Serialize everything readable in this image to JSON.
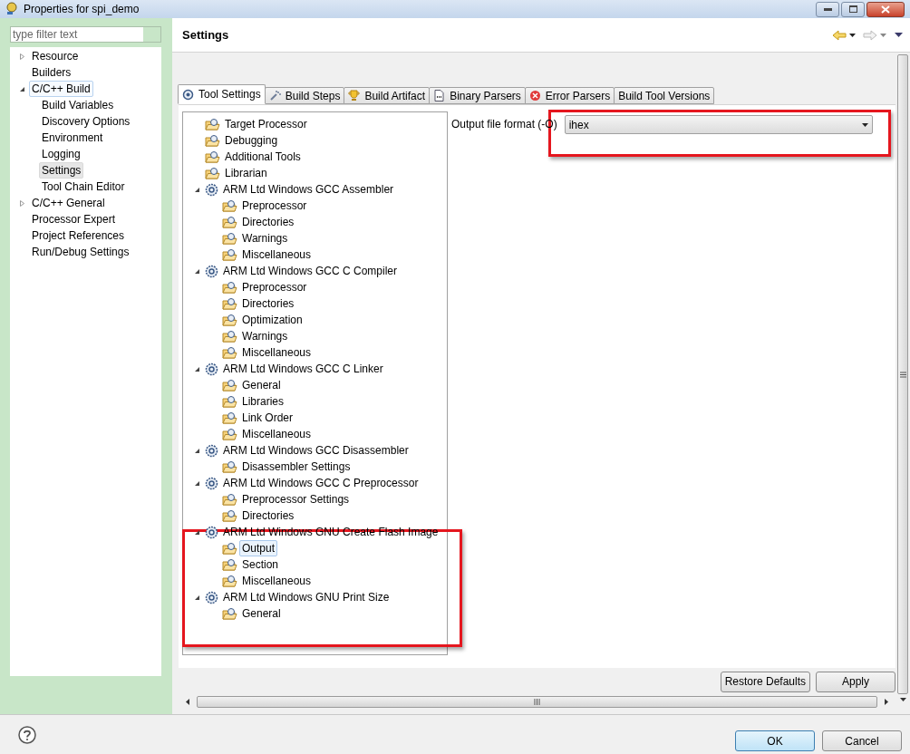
{
  "window": {
    "title": "Properties for spi_demo"
  },
  "sidebar": {
    "filter": {
      "placeholder": "type filter text"
    },
    "items": [
      {
        "label": "Resource",
        "expanded": false,
        "selected": false,
        "focused": false
      },
      {
        "label": "Builders",
        "selected": false,
        "focused": false
      },
      {
        "label": "C/C++ Build",
        "expanded": true,
        "selected": false,
        "focused": true,
        "children": [
          {
            "label": "Build Variables",
            "selected": false
          },
          {
            "label": "Discovery Options",
            "selected": false
          },
          {
            "label": "Environment",
            "selected": false
          },
          {
            "label": "Logging",
            "selected": false
          },
          {
            "label": "Settings",
            "selected": true
          },
          {
            "label": "Tool Chain Editor",
            "selected": false
          }
        ]
      },
      {
        "label": "C/C++ General",
        "expanded": false,
        "selected": false,
        "focused": false
      },
      {
        "label": "Processor Expert",
        "selected": false,
        "focused": false
      },
      {
        "label": "Project References",
        "selected": false,
        "focused": false
      },
      {
        "label": "Run/Debug Settings",
        "selected": false,
        "focused": false
      }
    ]
  },
  "page": {
    "title": "Settings"
  },
  "tabs": [
    {
      "label": "Tool Settings",
      "selected": true
    },
    {
      "label": "Build Steps",
      "selected": false
    },
    {
      "label": "Build Artifact",
      "selected": false
    },
    {
      "label": "Binary Parsers",
      "selected": false
    },
    {
      "label": "Error Parsers",
      "selected": false
    },
    {
      "label": "Build Tool Versions",
      "selected": false
    }
  ],
  "tool_tree": [
    {
      "label": "Target Processor",
      "kind": "option",
      "selected": false
    },
    {
      "label": "Debugging",
      "kind": "option",
      "selected": false
    },
    {
      "label": "Additional Tools",
      "kind": "option",
      "selected": false
    },
    {
      "label": "Librarian",
      "kind": "option",
      "selected": false
    },
    {
      "label": "ARM Ltd Windows GCC Assembler",
      "kind": "tool",
      "expanded": true,
      "selected": false,
      "children": [
        {
          "label": "Preprocessor",
          "kind": "option",
          "selected": false
        },
        {
          "label": "Directories",
          "kind": "option",
          "selected": false
        },
        {
          "label": "Warnings",
          "kind": "option",
          "selected": false
        },
        {
          "label": "Miscellaneous",
          "kind": "option",
          "selected": false
        }
      ]
    },
    {
      "label": "ARM Ltd Windows GCC C Compiler",
      "kind": "tool",
      "expanded": true,
      "selected": false,
      "children": [
        {
          "label": "Preprocessor",
          "kind": "option",
          "selected": false
        },
        {
          "label": "Directories",
          "kind": "option",
          "selected": false
        },
        {
          "label": "Optimization",
          "kind": "option",
          "selected": false
        },
        {
          "label": "Warnings",
          "kind": "option",
          "selected": false
        },
        {
          "label": "Miscellaneous",
          "kind": "option",
          "selected": false
        }
      ]
    },
    {
      "label": "ARM Ltd Windows GCC C Linker",
      "kind": "tool",
      "expanded": true,
      "selected": false,
      "children": [
        {
          "label": "General",
          "kind": "option",
          "selected": false
        },
        {
          "label": "Libraries",
          "kind": "option",
          "selected": false
        },
        {
          "label": "Link Order",
          "kind": "option",
          "selected": false
        },
        {
          "label": "Miscellaneous",
          "kind": "option",
          "selected": false
        }
      ]
    },
    {
      "label": "ARM Ltd Windows GCC Disassembler",
      "kind": "tool",
      "expanded": true,
      "selected": false,
      "children": [
        {
          "label": "Disassembler Settings",
          "kind": "option",
          "selected": false
        }
      ]
    },
    {
      "label": "ARM Ltd Windows GCC C Preprocessor",
      "kind": "tool",
      "expanded": true,
      "selected": false,
      "children": [
        {
          "label": "Preprocessor Settings",
          "kind": "option",
          "selected": false
        },
        {
          "label": "Directories",
          "kind": "option",
          "selected": false
        }
      ]
    },
    {
      "label": "ARM Ltd Windows GNU Create Flash Image",
      "kind": "tool",
      "expanded": true,
      "selected": false,
      "children": [
        {
          "label": "Output",
          "kind": "option",
          "selected": true
        },
        {
          "label": "Section",
          "kind": "option",
          "selected": false
        },
        {
          "label": "Miscellaneous",
          "kind": "option",
          "selected": false
        }
      ]
    },
    {
      "label": "ARM Ltd Windows GNU Print Size",
      "kind": "tool",
      "expanded": true,
      "selected": false,
      "children": [
        {
          "label": "General",
          "kind": "option",
          "selected": false
        }
      ]
    }
  ],
  "option": {
    "label": "Output file format (-O)",
    "value": "ihex"
  },
  "page_buttons": [
    "Restore Defaults",
    "Apply"
  ],
  "dialog_buttons": [
    {
      "label": "OK",
      "default": true
    },
    {
      "label": "Cancel",
      "default": false
    }
  ]
}
